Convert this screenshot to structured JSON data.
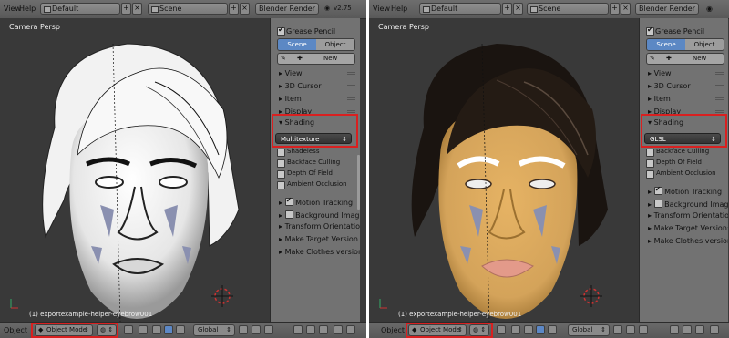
{
  "left": {
    "topbar": {
      "menu_view": "View",
      "menu_help": "Help",
      "layout": "Default",
      "scene": "Scene",
      "engine": "Blender Render",
      "version": "v2.75"
    },
    "viewport": {
      "label": "Camera Persp",
      "object_label": "(1) exportexample-helper-eyebrow001"
    },
    "panel": {
      "grease_pencil": "Grease Pencil",
      "tab_scene": "Scene",
      "tab_object": "Object",
      "new_label": "New",
      "sections": [
        "View",
        "3D Cursor",
        "Item",
        "Display"
      ],
      "shading": "Shading",
      "shading_mode": "Multitexture",
      "options": [
        "Shadeless",
        "Backface Culling",
        "Depth Of Field",
        "Ambient Occlusion"
      ],
      "sections2": [
        "Motion Tracking",
        "Background Images",
        "Transform Orientations",
        "Make Target  Version 1.",
        "Make Clothes version: 1."
      ]
    },
    "bottom": {
      "object": "Object",
      "mode": "Object Mode",
      "orientation": "Global"
    }
  },
  "right": {
    "topbar": {
      "menu_view": "View",
      "menu_help": "Help",
      "layout": "Default",
      "scene": "Scene",
      "engine": "Blender Render"
    },
    "viewport": {
      "label": "Camera Persp",
      "object_label": "(1) exportexample-helper-eyebrow001"
    },
    "panel": {
      "grease_pencil": "Grease Pencil",
      "tab_scene": "Scene",
      "tab_object": "Object",
      "new_label": "New",
      "sections": [
        "View",
        "3D Cursor",
        "Item",
        "Display"
      ],
      "shading": "Shading",
      "shading_mode": "GLSL",
      "options": [
        "Backface Culling",
        "Depth Of Field",
        "Ambient Occlusion"
      ],
      "sections2": [
        "Motion Tracking",
        "Background Images",
        "Transform Orientations",
        "Make Target  Version: 1.",
        "Make Clothes version: 1."
      ]
    },
    "bottom": {
      "object": "Object",
      "mode": "Object Mode",
      "orientation": "Global"
    }
  },
  "colors": {
    "highlight": "#d92020",
    "active_tab": "#5c88c4",
    "panel": "#727272",
    "viewport": "#393939",
    "skin": "#d4a35a",
    "hair": "#1a1410"
  },
  "icons": [
    "checkbox-icon",
    "pencil-icon",
    "plus-icon",
    "cube-icon",
    "cursor-icon",
    "axis-icon"
  ]
}
